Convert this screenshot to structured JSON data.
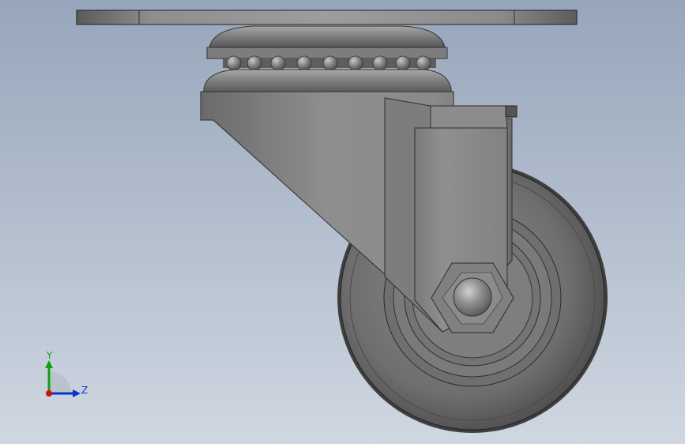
{
  "viewport": {
    "background_top": "#97a6bb",
    "background_bottom": "#cfd7e1"
  },
  "model": {
    "name": "swivel-caster-wheel",
    "view": "side-view",
    "shading": "grey-metal"
  },
  "triad": {
    "y_label": "Y",
    "z_label": "Z",
    "y_color": "#10a010",
    "z_color": "#1030d0",
    "x_color": "#d01010"
  }
}
